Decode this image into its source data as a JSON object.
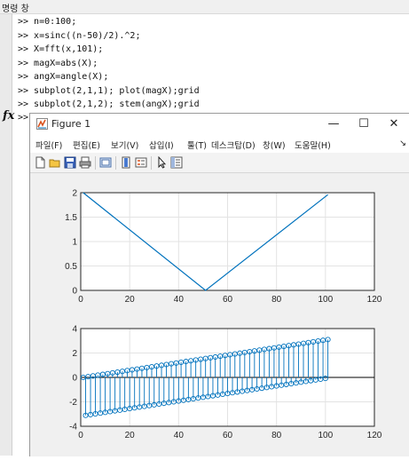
{
  "panel": {
    "title": "명령 창"
  },
  "command_lines": [
    ">> n=0:100;",
    ">> x=sinc((n-50)/2).^2;",
    ">> X=fft(x,101);",
    ">> magX=abs(X);",
    ">> angX=angle(X);",
    ">> subplot(2,1,1); plot(magX);grid",
    ">> subplot(2,1,2); stem(angX);grid"
  ],
  "prompt": ">>",
  "fx_label": "fx",
  "figure": {
    "title": "Figure 1",
    "window_buttons": {
      "minimize": "—",
      "maximize": "☐",
      "close": "✕"
    },
    "menus": [
      "파일(F)",
      "편집(E)",
      "보기(V)",
      "삽입(I)",
      "툴(T)",
      "데스크탑(D)",
      "창(W)",
      "도움말(H)"
    ],
    "menu_overflow": "↘",
    "toolbar_icons": [
      "new-figure-icon",
      "open-file-icon",
      "save-icon",
      "print-icon",
      "link-plot-icon",
      "colorbar-icon",
      "legend-icon",
      "pointer-icon",
      "property-editor-icon"
    ]
  },
  "chart_data": [
    {
      "type": "line",
      "xlim": [
        0,
        120
      ],
      "ylim": [
        0,
        2
      ],
      "xticks": [
        "0",
        "20",
        "40",
        "60",
        "80",
        "100",
        "120"
      ],
      "yticks": [
        "0",
        "0.5",
        "1",
        "1.5",
        "2"
      ],
      "grid": true,
      "color": "#0072bd",
      "x": [
        1,
        51,
        101
      ],
      "y": [
        2,
        0,
        1.96
      ]
    },
    {
      "type": "stem",
      "xlim": [
        0,
        120
      ],
      "ylim": [
        -4,
        4
      ],
      "xticks": [
        "0",
        "20",
        "40",
        "60",
        "80",
        "100",
        "120"
      ],
      "yticks": [
        "-4",
        "-2",
        "0",
        "2",
        "4"
      ],
      "grid": true,
      "color": "#0072bd",
      "x_start": 1,
      "x_end": 101,
      "upper_start": -0.0,
      "upper_end": 3.1,
      "lower_start": -3.14,
      "lower_end": -0.05
    }
  ]
}
